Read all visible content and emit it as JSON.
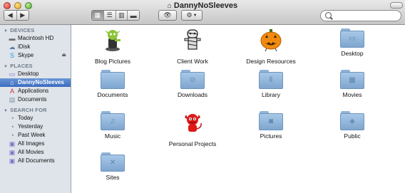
{
  "window": {
    "title": "DannyNoSleeves"
  },
  "toolbar": {
    "search_placeholder": ""
  },
  "sidebar": {
    "sections": [
      {
        "heading": "DEVICES",
        "items": [
          {
            "label": "Macintosh HD",
            "icon": "harddisk-icon"
          },
          {
            "label": "iDisk",
            "icon": "idisk-icon"
          },
          {
            "label": "Skype",
            "icon": "skype-icon",
            "eject": true
          }
        ]
      },
      {
        "heading": "PLACES",
        "items": [
          {
            "label": "Desktop",
            "icon": "desktop-icon"
          },
          {
            "label": "DannyNoSleeves",
            "icon": "home-icon",
            "selected": true
          },
          {
            "label": "Applications",
            "icon": "applications-icon"
          },
          {
            "label": "Documents",
            "icon": "documents-icon"
          }
        ]
      },
      {
        "heading": "SEARCH FOR",
        "items": [
          {
            "label": "Today",
            "icon": "clock-icon"
          },
          {
            "label": "Yesterday",
            "icon": "clock-icon"
          },
          {
            "label": "Past Week",
            "icon": "clock-icon"
          },
          {
            "label": "All Images",
            "icon": "smart-folder-icon"
          },
          {
            "label": "All Movies",
            "icon": "smart-folder-icon"
          },
          {
            "label": "All Documents",
            "icon": "smart-folder-icon"
          }
        ]
      }
    ]
  },
  "content": {
    "items": [
      {
        "label": "Blog Pictures",
        "icon": "goblin-icon"
      },
      {
        "label": "Client Work",
        "icon": "mummy-icon"
      },
      {
        "label": "Design Resources",
        "icon": "pumpkin-icon"
      },
      {
        "label": "Desktop",
        "icon": "desktop-folder-icon"
      },
      {
        "label": "Documents",
        "icon": "folder-icon"
      },
      {
        "label": "Downloads",
        "icon": "downloads-folder-icon"
      },
      {
        "label": "Library",
        "icon": "library-folder-icon"
      },
      {
        "label": "Movies",
        "icon": "movies-folder-icon"
      },
      {
        "label": "Music",
        "icon": "music-folder-icon"
      },
      {
        "label": "Personal Projects",
        "icon": "devil-icon"
      },
      {
        "label": "Pictures",
        "icon": "pictures-folder-icon"
      },
      {
        "label": "Public",
        "icon": "public-folder-icon"
      },
      {
        "label": "Sites",
        "icon": "sites-folder-icon"
      }
    ]
  },
  "colors": {
    "selection": "#3a6bc0",
    "folder": "#92b6dc",
    "sidebar_bg": "#dfe4ea"
  }
}
